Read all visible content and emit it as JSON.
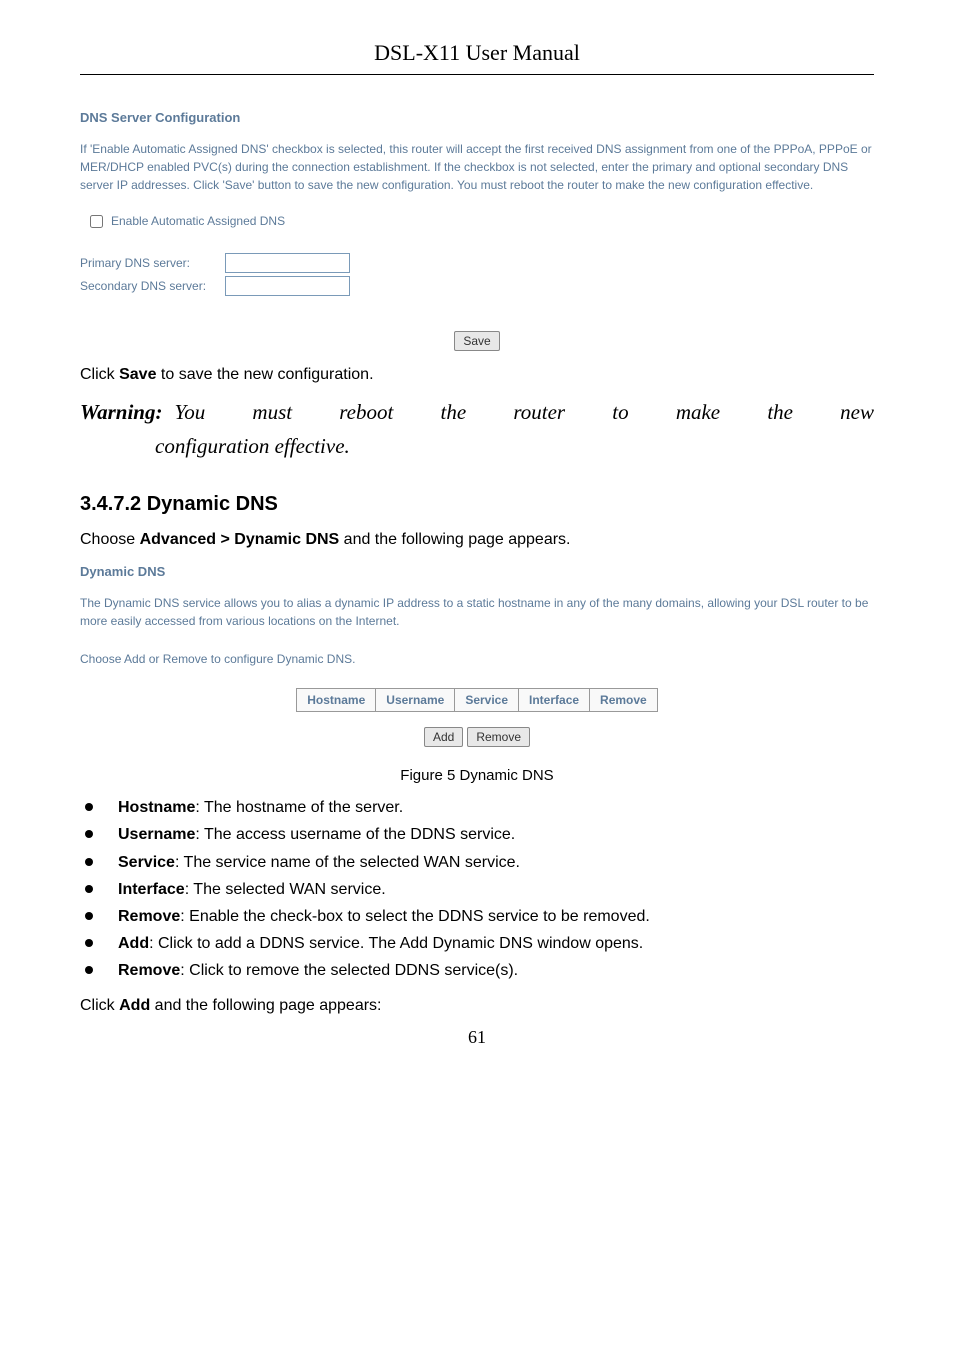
{
  "header": {
    "title": "DSL-X11 User Manual"
  },
  "dnsConfig": {
    "heading": "DNS Server Configuration",
    "description": "If 'Enable Automatic Assigned DNS' checkbox is selected, this router will accept the first received DNS assignment from one of the PPPoA, PPPoE or MER/DHCP enabled PVC(s) during the connection establishment. If the checkbox is not selected, enter the primary and optional secondary DNS server IP addresses. Click 'Save' button to save the new configuration. You must reboot the router to make the new configuration effective.",
    "checkboxLabel": "Enable Automatic Assigned DNS",
    "primaryLabel": "Primary DNS server:",
    "secondaryLabel": "Secondary DNS server:",
    "saveButton": "Save"
  },
  "saveNote": {
    "prefix": "Click ",
    "bold": "Save",
    "suffix": " to save the new configuration."
  },
  "warning": {
    "label": "Warning:",
    "line1": " You must reboot the router to make the new",
    "line2": "configuration effective."
  },
  "dynamicDns": {
    "heading": "3.4.7.2  Dynamic DNS",
    "choosePrefix": "Choose ",
    "chooseBold": "Advanced > Dynamic DNS",
    "chooseSuffix": " and the following page appears.",
    "subheading": "Dynamic DNS",
    "description": "The Dynamic DNS service allows you to alias a dynamic IP address to a static hostname in any of the many domains, allowing your DSL router to be more easily accessed from various locations on the Internet.",
    "instruction": "Choose Add or Remove to configure Dynamic DNS.",
    "tableHeaders": {
      "hostname": "Hostname",
      "username": "Username",
      "service": "Service",
      "interface": "Interface",
      "remove": "Remove"
    },
    "addButton": "Add",
    "removeButton": "Remove",
    "figureCaption": "Figure 5 Dynamic DNS"
  },
  "bullets": {
    "b1": {
      "bold": "Hostname",
      "text": ": The hostname of the server."
    },
    "b2": {
      "bold": "Username",
      "text": ": The access username of the DDNS service."
    },
    "b3": {
      "bold": "Service",
      "text": ": The service name of the selected WAN service."
    },
    "b4": {
      "bold": "Interface",
      "text": ": The selected WAN service."
    },
    "b5": {
      "bold": "Remove",
      "text": ": Enable the check-box to select the DDNS service to be removed."
    },
    "b6": {
      "bold": "Add",
      "text": ": Click to add a DDNS service. The Add Dynamic DNS window opens."
    },
    "b7": {
      "bold": "Remove",
      "text": ": Click to remove the selected DDNS service(s)."
    }
  },
  "clickAdd": {
    "prefix": "Click ",
    "bold": "Add",
    "suffix": " and the following page appears:"
  },
  "pageNumber": "61"
}
